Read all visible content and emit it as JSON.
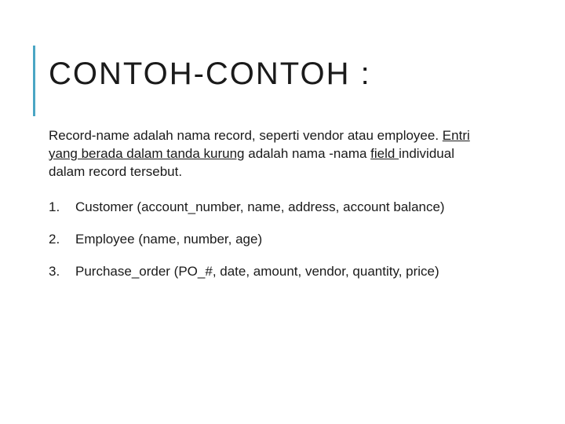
{
  "title": "CONTOH-CONTOH :",
  "paragraph": {
    "p1": "Record-name adalah nama record, seperti vendor atau employee. ",
    "u1": "Entri yang berada dalam tanda kurung",
    "p2": " adalah nama -nama ",
    "u2": "field ",
    "p3": "individual dalam record tersebut."
  },
  "items": [
    {
      "num": "1.",
      "text": "Customer (account_number, name, address, account balance)"
    },
    {
      "num": "2.",
      "text": "Employee (name, number, age)"
    },
    {
      "num": "3.",
      "text": "Purchase_order (PO_#, date, amount, vendor, quantity, price)"
    }
  ]
}
